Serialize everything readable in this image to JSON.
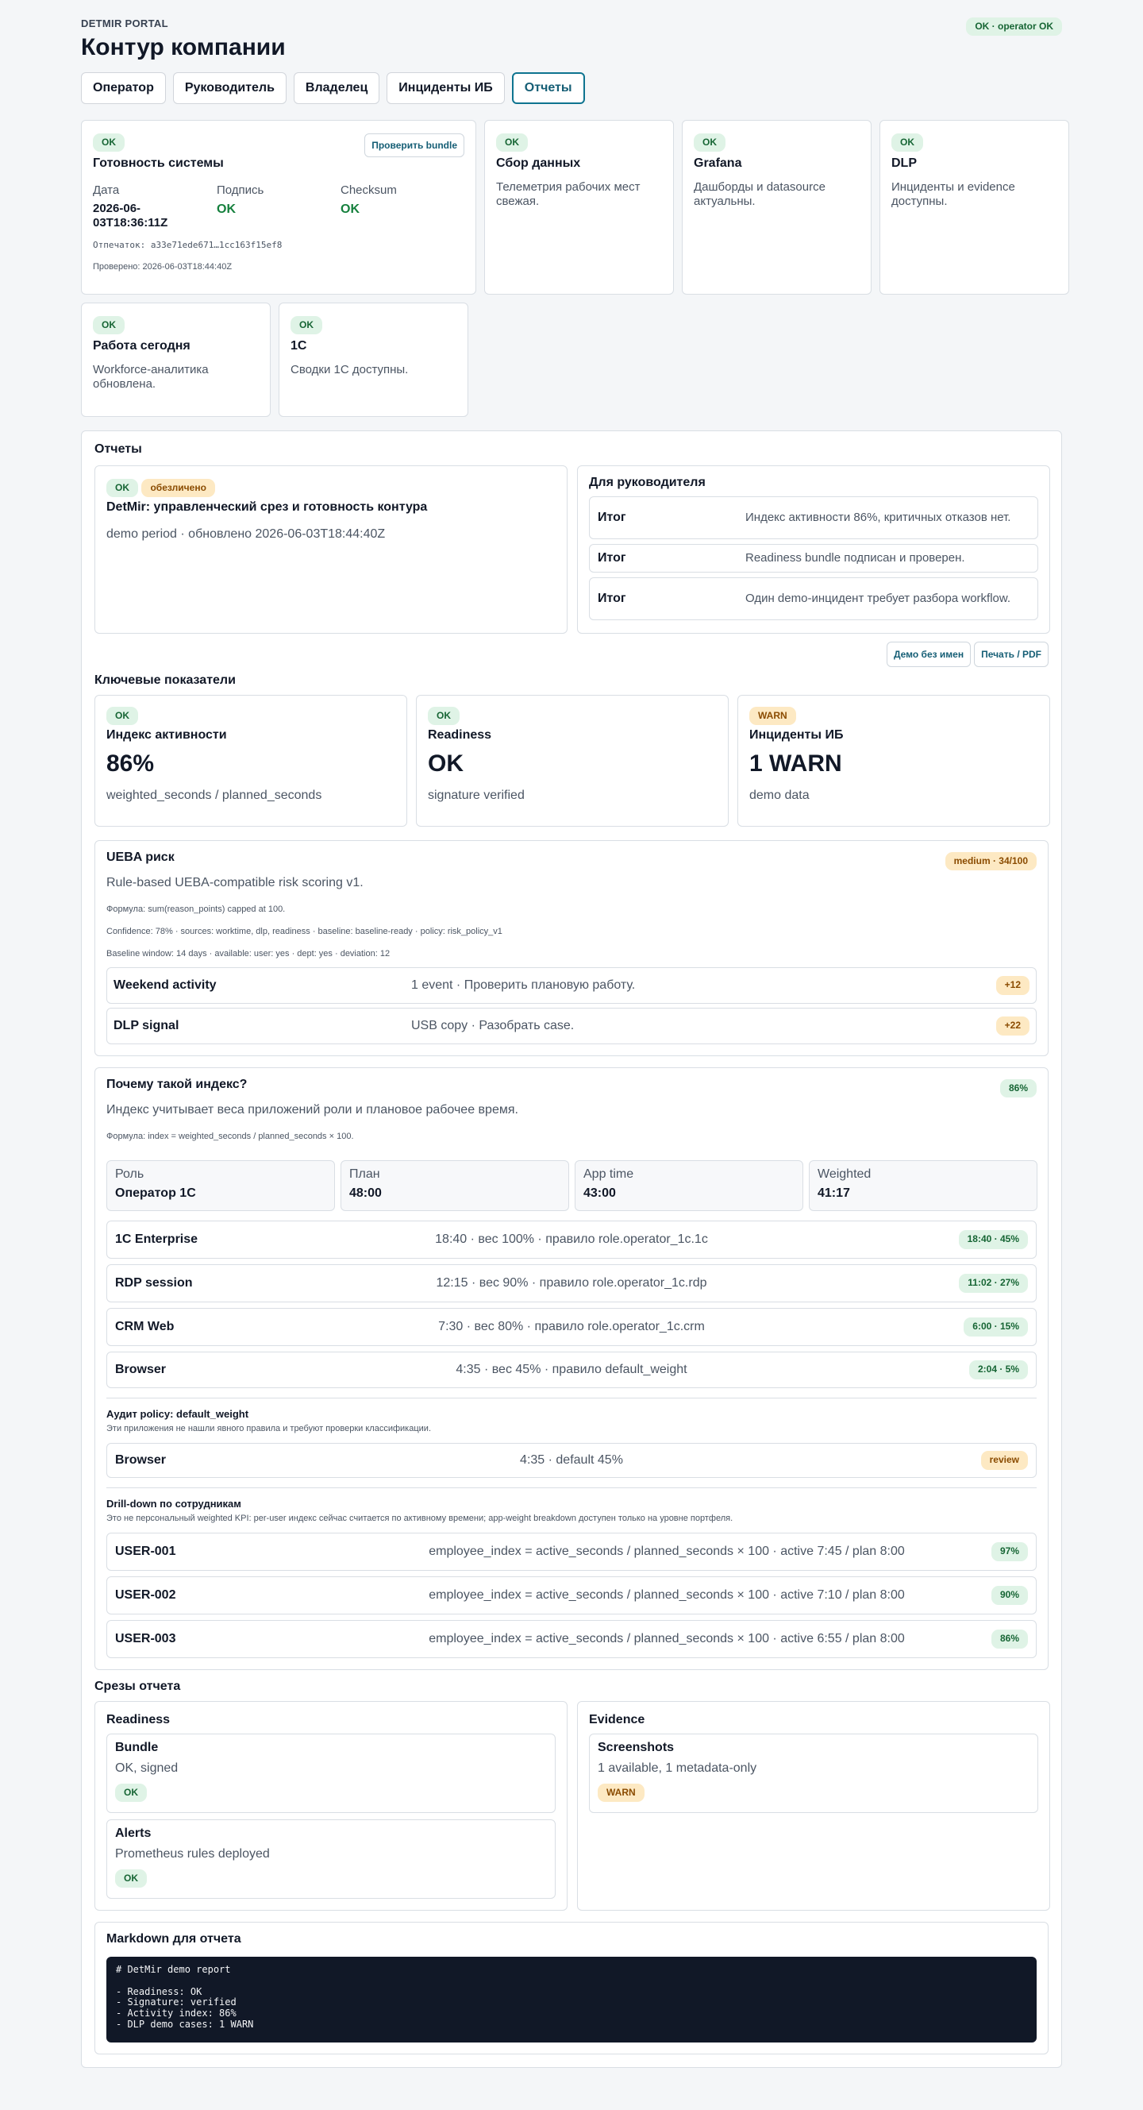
{
  "brand": "DETMIR PORTAL",
  "title": "Контур компании",
  "status_badge": "OK · operator OK",
  "tabs": [
    "Оператор",
    "Руководитель",
    "Владелец",
    "Инциденты ИБ",
    "Отчеты"
  ],
  "readiness": {
    "badge": "OK",
    "title": "Готовность системы",
    "verify_button": "Проверить bundle",
    "date_label": "Дата",
    "date_value": "2026-06-03T18:36:11Z",
    "signature_label": "Подпись",
    "signature_value": "OK",
    "checksum_label": "Checksum",
    "checksum_value": "OK",
    "fingerprint": "Отпечаток: a33e71ede671…1cc163f15ef8",
    "checked": "Проверено: 2026-06-03T18:44:40Z"
  },
  "status_cards": [
    {
      "badge": "OK",
      "title": "Сбор данных",
      "text": "Телеметрия рабочих мест свежая."
    },
    {
      "badge": "OK",
      "title": "Grafana",
      "text": "Дашборды и datasource актуальны."
    },
    {
      "badge": "OK",
      "title": "DLP",
      "text": "Инциденты и evidence доступны."
    },
    {
      "badge": "OK",
      "title": "Работа сегодня",
      "text": "Workforce-аналитика обновлена."
    },
    {
      "badge": "OK",
      "title": "1С",
      "text": "Сводки 1С доступны."
    }
  ],
  "reports": {
    "title": "Отчеты",
    "main": {
      "badge_ok": "OK",
      "badge_anon": "обезличено",
      "title": "DetMir: управленческий срез и готовность контура",
      "subtitle": "demo period · обновлено 2026-06-03T18:44:40Z"
    },
    "manager": {
      "title": "Для руководителя",
      "rows": [
        {
          "k": "Итог",
          "v": "Индекс активности 86%, критичных отказов нет."
        },
        {
          "k": "Итог",
          "v": "Readiness bundle подписан и проверен."
        },
        {
          "k": "Итог",
          "v": "Один demo-инцидент требует разбора workflow."
        }
      ]
    },
    "buttons": {
      "demo": "Демо без имен",
      "print": "Печать / PDF"
    },
    "kpi_title": "Ключевые показатели",
    "kpis": [
      {
        "badge": "OK",
        "title": "Индекс активности",
        "value": "86%",
        "sub": "weighted_seconds / planned_seconds"
      },
      {
        "badge": "OK",
        "title": "Readiness",
        "value": "OK",
        "sub": "signature verified"
      },
      {
        "badge": "WARN",
        "title": "Инциденты ИБ",
        "value": "1 WARN",
        "sub": "demo data"
      }
    ],
    "ueba": {
      "title": "UEBA риск",
      "badge": "medium · 34/100",
      "subtitle": "Rule-based UEBA-compatible risk scoring v1.",
      "formula": "Формула: sum(reason_points) capped at 100.",
      "confidence": "Confidence: 78% · sources: worktime, dlp, readiness · baseline: baseline-ready · policy: risk_policy_v1",
      "baseline": "Baseline window: 14 days · available: user: yes · dept: yes · deviation: 12",
      "rows": [
        {
          "name": "Weekend activity",
          "desc": "1 event · Проверить плановую работу.",
          "badge": "+12"
        },
        {
          "name": "DLP signal",
          "desc": "USB copy · Разобрать case.",
          "badge": "+22"
        }
      ]
    },
    "index": {
      "title": "Почему такой индекс?",
      "badge": "86%",
      "subtitle": "Индекс учитывает веса приложений роли и плановое рабочее время.",
      "formula": "Формула: index = weighted_seconds / planned_seconds × 100.",
      "stats": [
        {
          "label": "Роль",
          "value": "Оператор 1С"
        },
        {
          "label": "План",
          "value": "48:00"
        },
        {
          "label": "App time",
          "value": "43:00"
        },
        {
          "label": "Weighted",
          "value": "41:17"
        }
      ],
      "apps": [
        {
          "name": "1C Enterprise",
          "desc": "18:40 · вес 100% · правило role.operator_1c.1c",
          "badge": "18:40 · 45%"
        },
        {
          "name": "RDP session",
          "desc": "12:15 · вес 90% · правило role.operator_1c.rdp",
          "badge": "11:02 · 27%"
        },
        {
          "name": "CRM Web",
          "desc": "7:30 · вес 80% · правило role.operator_1c.crm",
          "badge": "6:00 · 15%"
        },
        {
          "name": "Browser",
          "desc": "4:35 · вес 45% · правило default_weight",
          "badge": "2:04 · 5%"
        }
      ],
      "audit_title": "Аудит policy: default_weight",
      "audit_text": "Эти приложения не нашли явного правила и требуют проверки классификации.",
      "audit_rows": [
        {
          "name": "Browser",
          "desc": "4:35 · default 45%",
          "badge": "review"
        }
      ],
      "drill_title": "Drill-down по сотрудникам",
      "drill_text": "Это не персональный weighted KPI: per-user индекс сейчас считается по активному времени; app-weight breakdown доступен только на уровне портфеля.",
      "users": [
        {
          "name": "USER-001",
          "desc": "employee_index = active_seconds / planned_seconds × 100 · active 7:45 / plan 8:00",
          "badge": "97%"
        },
        {
          "name": "USER-002",
          "desc": "employee_index = active_seconds / planned_seconds × 100 · active 7:10 / plan 8:00",
          "badge": "90%"
        },
        {
          "name": "USER-003",
          "desc": "employee_index = active_seconds / planned_seconds × 100 · active 6:55 / plan 8:00",
          "badge": "86%"
        }
      ]
    },
    "slices_title": "Срезы отчета",
    "slices": {
      "readiness": {
        "title": "Readiness",
        "items": [
          {
            "t": "Bundle",
            "d": "OK, signed",
            "badge": "OK"
          },
          {
            "t": "Alerts",
            "d": "Prometheus rules deployed",
            "badge": "OK"
          }
        ]
      },
      "evidence": {
        "title": "Evidence",
        "items": [
          {
            "t": "Screenshots",
            "d": "1 available, 1 metadata-only",
            "badge": "WARN"
          }
        ]
      }
    },
    "markdown": {
      "title": "Markdown для отчета",
      "code": "# DetMir demo report\n\n- Readiness: OK\n- Signature: verified\n- Activity index: 86%\n- DLP demo cases: 1 WARN"
    }
  }
}
